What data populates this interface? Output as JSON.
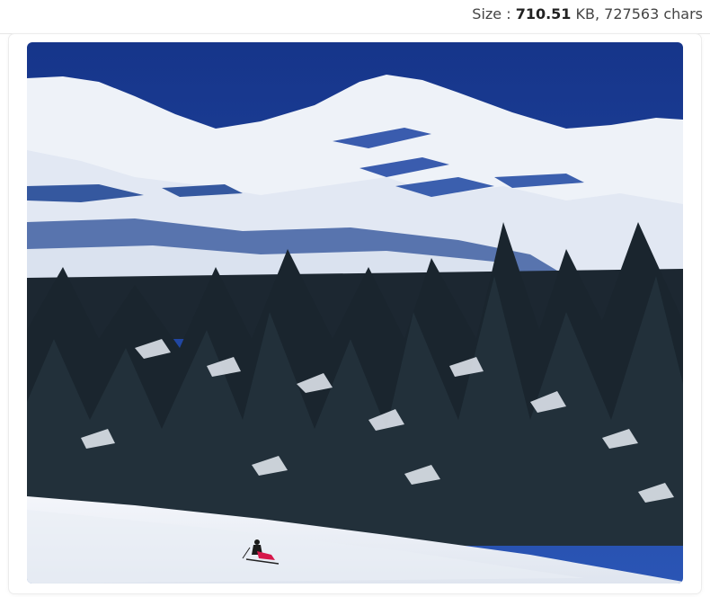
{
  "header": {
    "size_label": "Size : ",
    "size_value": "710.51",
    "size_unit": " KB, ",
    "char_count": "727563 chars"
  },
  "image": {
    "subject": "snow-mountain-skier-photo",
    "colors": {
      "sky": "#1b3f96",
      "snow": "#eef2f8",
      "shadow": "#3b5fae",
      "trees": "#1e2a33",
      "skier": "#d6174a"
    }
  }
}
